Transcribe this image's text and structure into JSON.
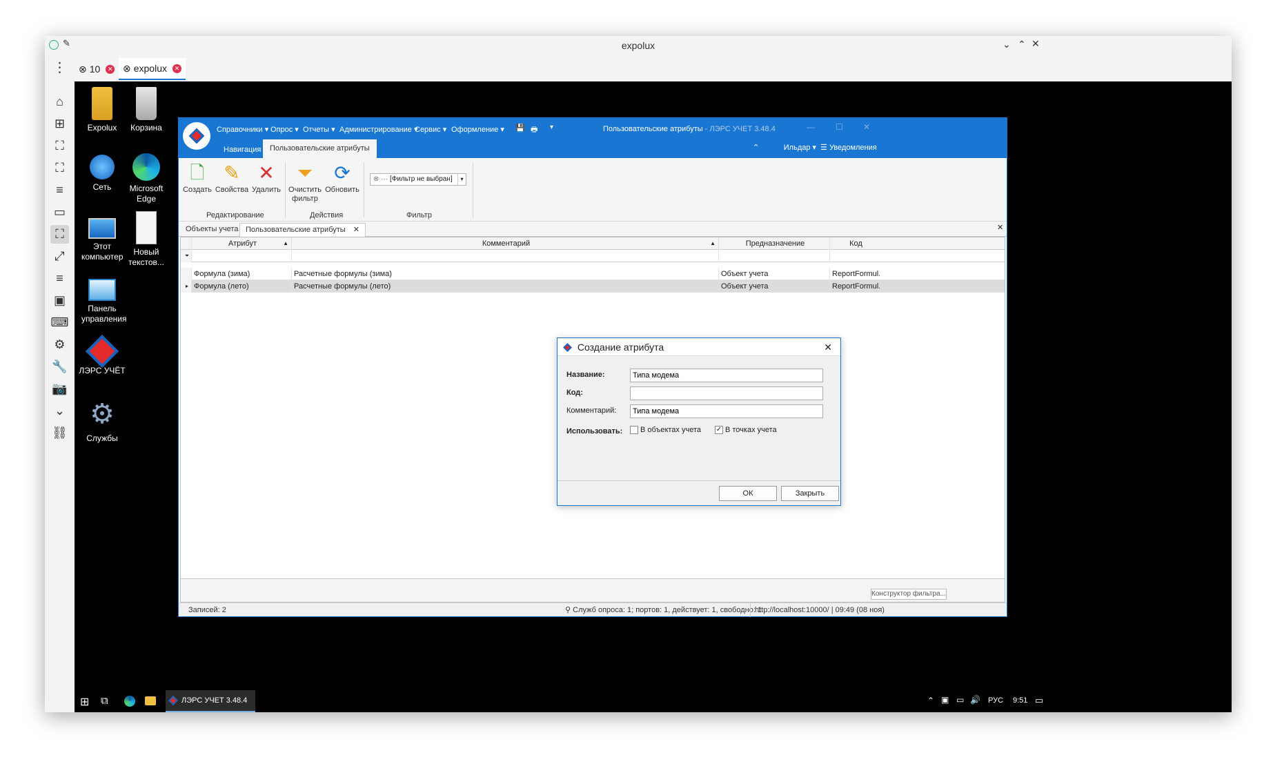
{
  "window": {
    "title": "expolux"
  },
  "browser_tabs": [
    {
      "label": "10"
    },
    {
      "label": "expolux"
    }
  ],
  "desktop_icons": [
    {
      "label": "Expolux"
    },
    {
      "label": "Корзина"
    },
    {
      "label": "Сеть"
    },
    {
      "label": "Microsoft Edge"
    },
    {
      "label": "Этот компьютер"
    },
    {
      "label": "Новый текстов..."
    },
    {
      "label": "Панель управления"
    },
    {
      "label": "ЛЭРС УЧЁТ"
    },
    {
      "label": "Службы"
    }
  ],
  "app": {
    "menu": [
      "Справочники ▾",
      "Опрос ▾",
      "Отчеты ▾",
      "Администрирование ▾",
      "Сервис ▾",
      "Оформление ▾"
    ],
    "title": "Пользовательские атрибуты",
    "title_suffix": " - ЛЭРС УЧЕТ 3.48.4",
    "ribbon_tabs": [
      "Навигация",
      "Пользовательские атрибуты"
    ],
    "user": "Ильдар ▾",
    "notifications": "Уведомления",
    "ribbon": {
      "create": "Создать",
      "properties": "Свойства",
      "delete": "Удалить",
      "clear_filter": "Очистить фильтр",
      "refresh": "Обновить",
      "filter_value": "[Фильтр не выбран]",
      "group_edit": "Редактирование",
      "group_actions": "Действия",
      "group_filter": "Фильтр"
    },
    "doc_tabs": [
      "Объекты учета",
      "Пользовательские атрибуты"
    ],
    "grid": {
      "columns": [
        "Атрибут",
        "Комментарий",
        "Предназначение",
        "Код"
      ],
      "rows": [
        [
          "Формула (зима)",
          "Расчетные формулы (зима)",
          "Объект учета",
          "ReportFormul..."
        ],
        [
          "Формула (лето)",
          "Расчетные формулы (лето)",
          "Объект учета",
          "ReportFormul..."
        ]
      ]
    },
    "filter_builder": "Конструктор фильтра...",
    "status": {
      "records": "Записей: 2",
      "poll": "Служб опроса: 1; портов: 1, действует: 1, свободно: 1",
      "server": "http://localhost:10000/ | 09:49 (08 ноя)"
    }
  },
  "dialog": {
    "title": "Создание атрибута",
    "name_label": "Название:",
    "name_value": "Типа модема",
    "code_label": "Код:",
    "code_value": "",
    "comment_label": "Комментарий:",
    "comment_value": "Типа модема",
    "use_label": "Использовать:",
    "use_objects": "В объектах учета",
    "use_objects_checked": false,
    "use_points": "В точках учета",
    "use_points_checked": true,
    "ok": "ОК",
    "close": "Закрыть"
  },
  "taskbar": {
    "app_label": "ЛЭРС УЧЕТ 3.48.4",
    "lang": "РУС",
    "time": "9:51"
  }
}
